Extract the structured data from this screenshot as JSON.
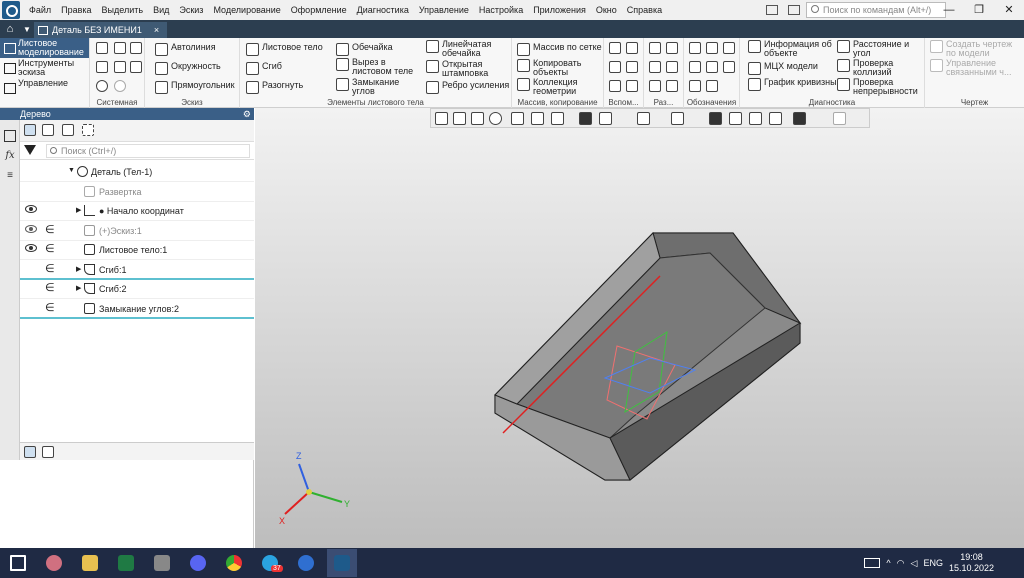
{
  "menu": [
    "Файл",
    "Правка",
    "Выделить",
    "Вид",
    "Эскиз",
    "Моделирование",
    "Оформление",
    "Диагностика",
    "Управление",
    "Настройка",
    "Приложения",
    "Окно",
    "Справка"
  ],
  "search_commands": {
    "placeholder": "Поиск по командам (Alt+/)"
  },
  "document_tab": {
    "title": "Деталь БЕЗ ИМЕНИ1",
    "close": "×"
  },
  "modes": [
    "Листовое моделирование",
    "Инструменты эскиза",
    "Управление"
  ],
  "ribbon": {
    "groups": [
      "Системная",
      "Эскиз",
      "Элементы листового тела",
      "Массив, копирование",
      "Вспом...",
      "Раз...",
      "Обозначения",
      "Диагностика",
      "Чертеж"
    ],
    "sketch": [
      "Автолиния",
      "Окружность",
      "Прямоугольник"
    ],
    "sheet": [
      "Листовое тело",
      "Сгиб",
      "Разогнуть",
      "Обечайка",
      "Вырез в листовом теле",
      "Замыкание углов",
      "Линейчатая обечайка",
      "Открытая штамповка",
      "Ребро усиления"
    ],
    "array": [
      "Массив по сетке",
      "Копировать объекты",
      "Коллекция геометрии"
    ],
    "diagnostics": [
      "Информация об объекте",
      "МЦХ модели",
      "График кривизны",
      "Расстояние и угол",
      "Проверка коллизий",
      "Проверка непрерывности"
    ],
    "drawing": [
      "Создать чертеж по модели",
      "Управление связанными ч..."
    ]
  },
  "tree": {
    "title": "Дерево",
    "search_placeholder": "Поиск (Ctrl+/)",
    "items": [
      {
        "label": "Деталь (Тел-1)"
      },
      {
        "label": "Развертка"
      },
      {
        "label": "● Начало координат"
      },
      {
        "label": "(+)Эскиз:1"
      },
      {
        "label": "Листовое тело:1"
      },
      {
        "label": "Сгиб:1"
      },
      {
        "label": "Сгиб:2"
      },
      {
        "label": "Замыкание углов:2"
      }
    ]
  },
  "axes": {
    "x": "X",
    "y": "Y",
    "z": "Z"
  },
  "taskbar": {
    "badge": "37",
    "lang": "ENG",
    "time": "19:08",
    "date": "15.10.2022"
  },
  "colors": {
    "accent": "#3a5f87",
    "taskbar": "#1f2a44",
    "axis_x": "#e02020",
    "axis_y": "#30b030",
    "axis_z": "#3060e0"
  }
}
